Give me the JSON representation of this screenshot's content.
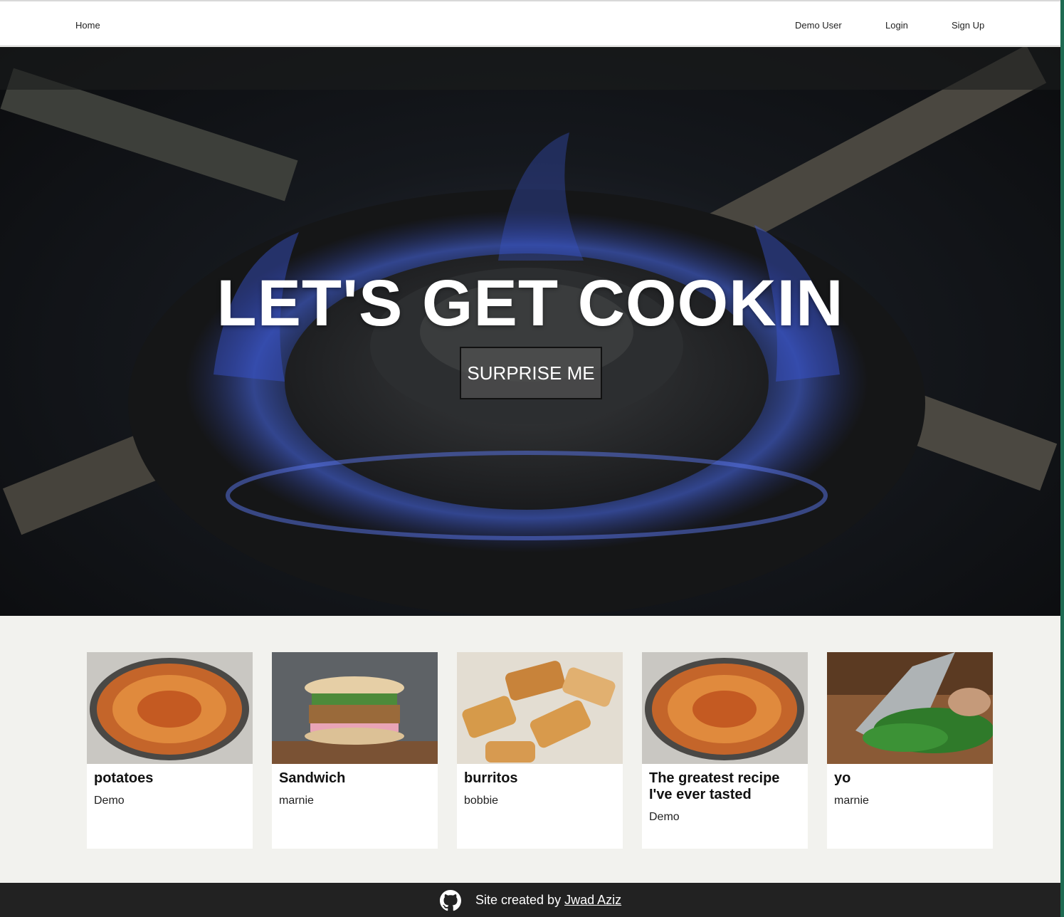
{
  "nav": {
    "home": "Home",
    "demo_user": "Demo User",
    "login": "Login",
    "sign_up": "Sign Up"
  },
  "hero": {
    "title": "LET'S GET COOKIN",
    "button": "SURPRISE ME"
  },
  "recipes": [
    {
      "title": "potatoes",
      "author": "Demo",
      "image": "potato-gratin-image"
    },
    {
      "title": "Sandwich",
      "author": "marnie",
      "image": "sandwich-image"
    },
    {
      "title": "burritos",
      "author": "bobbie",
      "image": "burritos-image"
    },
    {
      "title": "The greatest recipe I've ever tasted",
      "author": "Demo",
      "image": "potato-gratin-image"
    },
    {
      "title": "yo",
      "author": "marnie",
      "image": "chopping-herbs-image"
    }
  ],
  "footer": {
    "prefix": "Site created by",
    "author_link": "Jwad Aziz",
    "icon": "github-icon"
  },
  "colors": {
    "background": "#f2f2ee",
    "footer": "#222222",
    "flame": "#3b5bd6"
  }
}
